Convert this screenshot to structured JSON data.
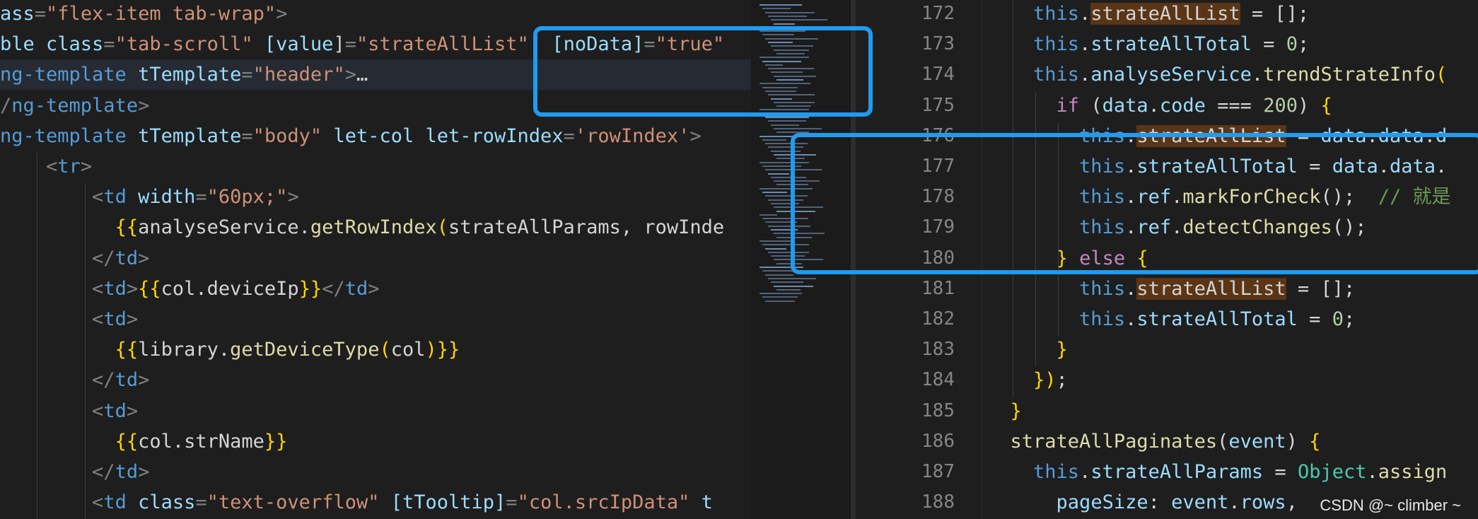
{
  "left_editor": {
    "lines": [
      [
        [
          "tok-attr",
          "ass"
        ],
        [
          "tok-punc",
          "="
        ],
        [
          "tok-str",
          "\"flex-item tab-wrap\""
        ],
        [
          "tok-punc",
          ">"
        ]
      ],
      [
        [
          "tok-attr",
          "ble class"
        ],
        [
          "tok-punc",
          "="
        ],
        [
          "tok-str",
          "\"tab-scroll\" "
        ],
        [
          "tok-attr",
          "[value"
        ],
        [
          "tok-text",
          "]"
        ],
        [
          "tok-punc",
          "="
        ],
        [
          "tok-str",
          "\"strateAllList\"  "
        ],
        [
          "tok-attr",
          "[noData]"
        ],
        [
          "tok-punc",
          "="
        ],
        [
          "tok-str",
          "\"true\""
        ]
      ],
      [
        [
          "tok-tag",
          "ng-template "
        ],
        [
          "tok-attr",
          "tTemplate"
        ],
        [
          "tok-punc",
          "="
        ],
        [
          "tok-str",
          "\"header\""
        ],
        [
          "tok-punc",
          ">"
        ],
        [
          "tok-text",
          "…"
        ]
      ],
      [
        [
          "tok-punc",
          "/"
        ],
        [
          "tok-tag",
          "ng-template"
        ],
        [
          "tok-punc",
          ">"
        ]
      ],
      [
        [
          "tok-tag",
          "ng-template "
        ],
        [
          "tok-attr",
          "tTemplate"
        ],
        [
          "tok-punc",
          "="
        ],
        [
          "tok-str",
          "\"body\" "
        ],
        [
          "tok-attr",
          "let-col let-rowIndex"
        ],
        [
          "tok-punc",
          "="
        ],
        [
          "tok-str",
          "'rowIndex'"
        ],
        [
          "tok-punc",
          ">"
        ]
      ],
      [
        [
          "tok-text",
          "    "
        ],
        [
          "tok-punc",
          "<"
        ],
        [
          "tok-tag",
          "tr"
        ],
        [
          "tok-punc",
          ">"
        ]
      ],
      [
        [
          "tok-text",
          "        "
        ],
        [
          "tok-punc",
          "<"
        ],
        [
          "tok-tag",
          "td "
        ],
        [
          "tok-attr",
          "width"
        ],
        [
          "tok-punc",
          "="
        ],
        [
          "tok-str",
          "\"60px;\""
        ],
        [
          "tok-punc",
          ">"
        ]
      ],
      [
        [
          "tok-text",
          "          "
        ],
        [
          "tok-brace",
          "{{"
        ],
        [
          "tok-text",
          "analyseService."
        ],
        [
          "tok-fn",
          "getRowIndex"
        ],
        [
          "tok-brace",
          "("
        ],
        [
          "tok-text",
          "strateAllParams, rowInde"
        ]
      ],
      [
        [
          "tok-text",
          "        "
        ],
        [
          "tok-punc",
          "</"
        ],
        [
          "tok-tag",
          "td"
        ],
        [
          "tok-punc",
          ">"
        ]
      ],
      [
        [
          "tok-text",
          "        "
        ],
        [
          "tok-punc",
          "<"
        ],
        [
          "tok-tag",
          "td"
        ],
        [
          "tok-punc",
          ">"
        ],
        [
          "tok-brace",
          "{{"
        ],
        [
          "tok-text",
          "col.deviceIp"
        ],
        [
          "tok-brace",
          "}}"
        ],
        [
          "tok-punc",
          "</"
        ],
        [
          "tok-tag",
          "td"
        ],
        [
          "tok-punc",
          ">"
        ]
      ],
      [
        [
          "tok-text",
          "        "
        ],
        [
          "tok-punc",
          "<"
        ],
        [
          "tok-tag",
          "td"
        ],
        [
          "tok-punc",
          ">"
        ]
      ],
      [
        [
          "tok-text",
          "          "
        ],
        [
          "tok-brace",
          "{{"
        ],
        [
          "tok-text",
          "library."
        ],
        [
          "tok-fn",
          "getDeviceType"
        ],
        [
          "tok-brace",
          "("
        ],
        [
          "tok-text",
          "col"
        ],
        [
          "tok-brace",
          ")}"
        ],
        [
          "tok-brace",
          "}"
        ]
      ],
      [
        [
          "tok-text",
          "        "
        ],
        [
          "tok-punc",
          "</"
        ],
        [
          "tok-tag",
          "td"
        ],
        [
          "tok-punc",
          ">"
        ]
      ],
      [
        [
          "tok-text",
          "        "
        ],
        [
          "tok-punc",
          "<"
        ],
        [
          "tok-tag",
          "td"
        ],
        [
          "tok-punc",
          ">"
        ]
      ],
      [
        [
          "tok-text",
          "          "
        ],
        [
          "tok-brace",
          "{{"
        ],
        [
          "tok-text",
          "col.strName"
        ],
        [
          "tok-brace",
          "}}"
        ]
      ],
      [
        [
          "tok-text",
          "        "
        ],
        [
          "tok-punc",
          "</"
        ],
        [
          "tok-tag",
          "td"
        ],
        [
          "tok-punc",
          ">"
        ]
      ],
      [
        [
          "tok-text",
          "        "
        ],
        [
          "tok-punc",
          "<"
        ],
        [
          "tok-tag",
          "td "
        ],
        [
          "tok-attr",
          "class"
        ],
        [
          "tok-punc",
          "="
        ],
        [
          "tok-str",
          "\"text-overflow\" "
        ],
        [
          "tok-attr",
          "[tTooltip]"
        ],
        [
          "tok-punc",
          "="
        ],
        [
          "tok-str",
          "\"col.srcIpData\" "
        ],
        [
          "tok-attr",
          "t"
        ]
      ]
    ]
  },
  "right_editor": {
    "lines": [
      {
        "num": "172",
        "tokens": [
          [
            "tok-text",
            "    "
          ],
          [
            "tok-this",
            "this"
          ],
          [
            "tok-text",
            "."
          ],
          [
            "occ",
            "strateAllList"
          ],
          [
            "tok-text",
            " = [];"
          ]
        ]
      },
      {
        "num": "173",
        "tokens": [
          [
            "tok-text",
            "    "
          ],
          [
            "tok-this",
            "this"
          ],
          [
            "tok-text",
            "."
          ],
          [
            "tok-prop",
            "strateAllTotal"
          ],
          [
            "tok-text",
            " = "
          ],
          [
            "tok-num",
            "0"
          ],
          [
            "tok-text",
            ";"
          ]
        ]
      },
      {
        "num": "174",
        "tokens": [
          [
            "tok-text",
            "    "
          ],
          [
            "tok-this",
            "this"
          ],
          [
            "tok-text",
            "."
          ],
          [
            "tok-prop",
            "analyseService"
          ],
          [
            "tok-text",
            "."
          ],
          [
            "tok-fn",
            "trendStrateInfo"
          ],
          [
            "tok-brace",
            "("
          ]
        ]
      },
      {
        "num": "175",
        "tokens": [
          [
            "tok-text",
            "      "
          ],
          [
            "tok-kw",
            "if"
          ],
          [
            "tok-text",
            " ("
          ],
          [
            "tok-prop",
            "data"
          ],
          [
            "tok-text",
            "."
          ],
          [
            "tok-prop",
            "code"
          ],
          [
            "tok-text",
            " === "
          ],
          [
            "tok-num",
            "200"
          ],
          [
            "tok-text",
            ") "
          ],
          [
            "tok-brace",
            "{"
          ]
        ]
      },
      {
        "num": "176",
        "tokens": [
          [
            "tok-text",
            "        "
          ],
          [
            "tok-this",
            "this"
          ],
          [
            "tok-text",
            "."
          ],
          [
            "occ",
            "strateAllList"
          ],
          [
            "tok-text",
            " = "
          ],
          [
            "tok-prop",
            "data"
          ],
          [
            "tok-text",
            "."
          ],
          [
            "tok-prop",
            "data"
          ],
          [
            "tok-text",
            "."
          ],
          [
            "tok-prop",
            "d"
          ]
        ]
      },
      {
        "num": "177",
        "tokens": [
          [
            "tok-text",
            "        "
          ],
          [
            "tok-this",
            "this"
          ],
          [
            "tok-text",
            "."
          ],
          [
            "tok-prop",
            "strateAllTotal"
          ],
          [
            "tok-text",
            " = "
          ],
          [
            "tok-prop",
            "data"
          ],
          [
            "tok-text",
            "."
          ],
          [
            "tok-prop",
            "data"
          ],
          [
            "tok-text",
            "."
          ]
        ]
      },
      {
        "num": "178",
        "tokens": [
          [
            "tok-text",
            "        "
          ],
          [
            "tok-this",
            "this"
          ],
          [
            "tok-text",
            "."
          ],
          [
            "tok-prop",
            "ref"
          ],
          [
            "tok-text",
            "."
          ],
          [
            "tok-fn",
            "markForCheck"
          ],
          [
            "tok-text",
            "();  "
          ],
          [
            "tok-cmt",
            "// 就是"
          ]
        ]
      },
      {
        "num": "179",
        "tokens": [
          [
            "tok-text",
            "        "
          ],
          [
            "tok-this",
            "this"
          ],
          [
            "tok-text",
            "."
          ],
          [
            "tok-prop",
            "ref"
          ],
          [
            "tok-text",
            "."
          ],
          [
            "tok-fn",
            "detectChanges"
          ],
          [
            "tok-text",
            "();"
          ]
        ]
      },
      {
        "num": "180",
        "tokens": [
          [
            "tok-text",
            "      "
          ],
          [
            "tok-brace",
            "}"
          ],
          [
            "tok-text",
            " "
          ],
          [
            "tok-kw",
            "else"
          ],
          [
            "tok-text",
            " "
          ],
          [
            "tok-brace",
            "{"
          ]
        ]
      },
      {
        "num": "181",
        "tokens": [
          [
            "tok-text",
            "        "
          ],
          [
            "tok-this",
            "this"
          ],
          [
            "tok-text",
            "."
          ],
          [
            "occ",
            "strateAllList"
          ],
          [
            "tok-text",
            " = [];"
          ]
        ]
      },
      {
        "num": "182",
        "tokens": [
          [
            "tok-text",
            "        "
          ],
          [
            "tok-this",
            "this"
          ],
          [
            "tok-text",
            "."
          ],
          [
            "tok-prop",
            "strateAllTotal"
          ],
          [
            "tok-text",
            " = "
          ],
          [
            "tok-num",
            "0"
          ],
          [
            "tok-text",
            ";"
          ]
        ]
      },
      {
        "num": "183",
        "tokens": [
          [
            "tok-text",
            "      "
          ],
          [
            "tok-brace",
            "}"
          ]
        ]
      },
      {
        "num": "184",
        "tokens": [
          [
            "tok-text",
            "    "
          ],
          [
            "tok-brace",
            "})"
          ],
          [
            "tok-text",
            ";"
          ]
        ]
      },
      {
        "num": "185",
        "tokens": [
          [
            "tok-text",
            "  "
          ],
          [
            "tok-brace",
            "}"
          ]
        ]
      },
      {
        "num": "186",
        "tokens": [
          [
            "tok-text",
            "  "
          ],
          [
            "tok-fn",
            "strateAllPaginates"
          ],
          [
            "tok-text",
            "("
          ],
          [
            "tok-prop",
            "event"
          ],
          [
            "tok-text",
            ") "
          ],
          [
            "tok-brace",
            "{"
          ]
        ]
      },
      {
        "num": "187",
        "tokens": [
          [
            "tok-text",
            "    "
          ],
          [
            "tok-this",
            "this"
          ],
          [
            "tok-text",
            "."
          ],
          [
            "tok-prop",
            "strateAllParams"
          ],
          [
            "tok-text",
            " = "
          ],
          [
            "tok-cls",
            "Object"
          ],
          [
            "tok-text",
            "."
          ],
          [
            "tok-fn",
            "assign"
          ]
        ]
      },
      {
        "num": "188",
        "tokens": [
          [
            "tok-text",
            "      "
          ],
          [
            "tok-prop",
            "pageSize"
          ],
          [
            "tok-text",
            ": "
          ],
          [
            "tok-prop",
            "event"
          ],
          [
            "tok-text",
            "."
          ],
          [
            "tok-prop",
            "rows"
          ],
          [
            "tok-text",
            ","
          ]
        ]
      }
    ]
  },
  "watermark": "CSDN @~ climber ~",
  "colors": {
    "editor_bg": "#1e1e1e",
    "highlight_box": "#1f9bf0",
    "occurrence_bg": "#5a3516"
  }
}
